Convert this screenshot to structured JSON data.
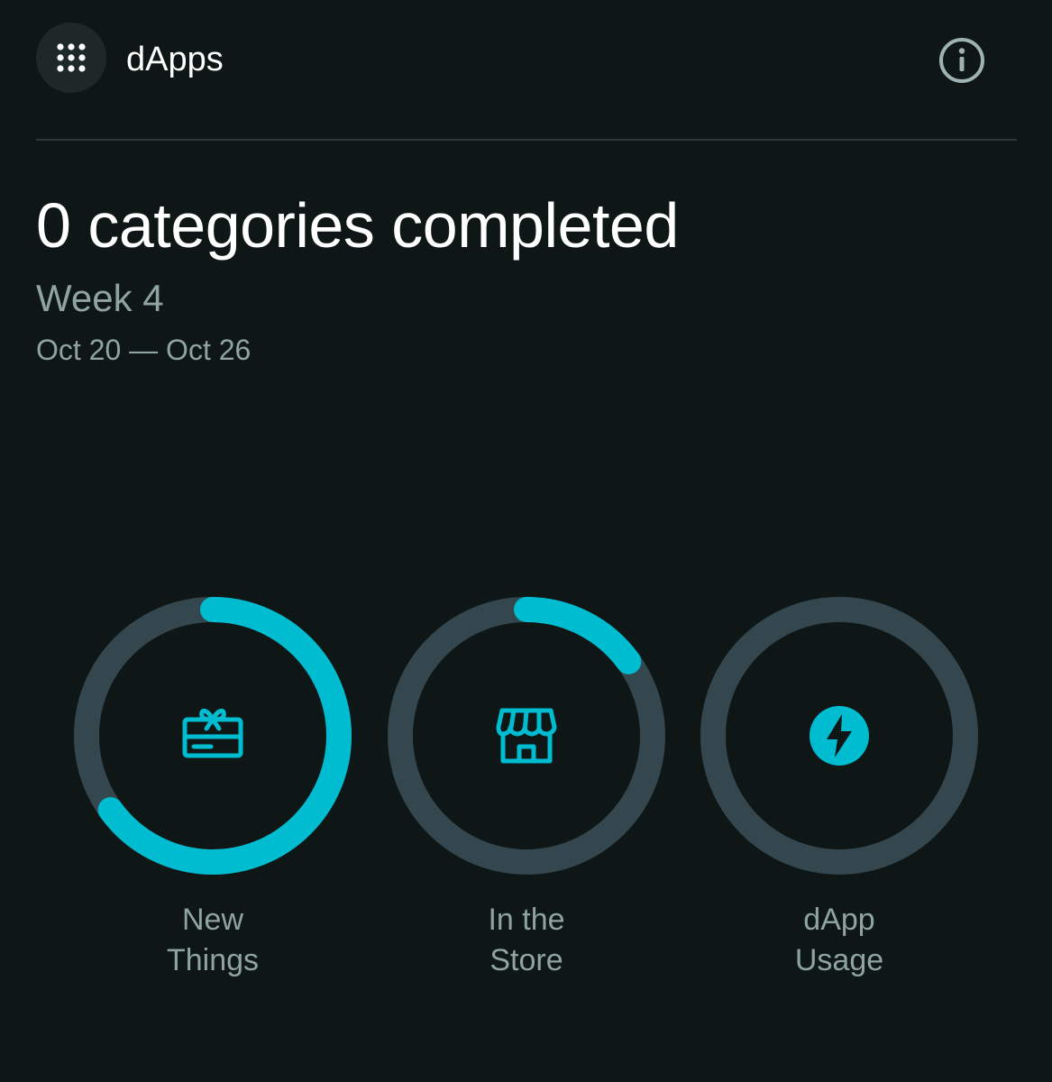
{
  "header": {
    "menu_icon": "grid-dots-icon",
    "title": "dApps",
    "info_icon": "info-icon"
  },
  "summary": {
    "headline": "0 categories completed",
    "week": "Week 4",
    "date_range": "Oct 20 — Oct 26"
  },
  "colors": {
    "background": "#0e1616",
    "ring_track": "#35474e",
    "ring_progress": "#00bcd0",
    "accent": "#00bcd0",
    "muted_text": "#8fa3a3"
  },
  "categories": [
    {
      "label_line1": "New",
      "label_line2": "Things",
      "icon": "gift-card-icon",
      "progress": 0.65
    },
    {
      "label_line1": "In the",
      "label_line2": "Store",
      "icon": "storefront-icon",
      "progress": 0.15
    },
    {
      "label_line1": "dApp",
      "label_line2": "Usage",
      "icon": "lightning-bolt-icon",
      "progress": 0
    }
  ]
}
